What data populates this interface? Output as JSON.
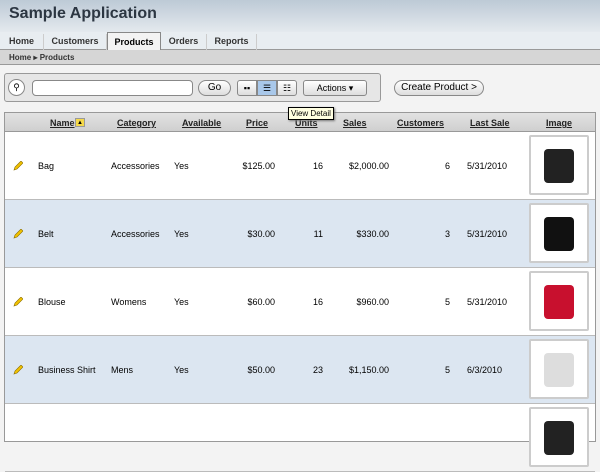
{
  "app": {
    "title": "Sample Application"
  },
  "tabs": [
    "Home",
    "Customers",
    "Products",
    "Orders",
    "Reports"
  ],
  "breadcrumb": {
    "home": "Home",
    "sep": "▸",
    "current": "Products"
  },
  "toolbar": {
    "search_value": "",
    "go": "Go",
    "actions": "Actions",
    "create": "Create Product >",
    "tooltip": "View Detail"
  },
  "columns": [
    "Name",
    "Category",
    "Available",
    "Price",
    "Units",
    "Sales",
    "Customers",
    "Last Sale",
    "Image"
  ],
  "rows": [
    {
      "name": "Bag",
      "category": "Accessories",
      "available": "Yes",
      "price": "$125.00",
      "units": "16",
      "sales": "$2,000.00",
      "customers": "6",
      "last_sale": "5/31/2010"
    },
    {
      "name": "Belt",
      "category": "Accessories",
      "available": "Yes",
      "price": "$30.00",
      "units": "11",
      "sales": "$330.00",
      "customers": "3",
      "last_sale": "5/31/2010"
    },
    {
      "name": "Blouse",
      "category": "Womens",
      "available": "Yes",
      "price": "$60.00",
      "units": "16",
      "sales": "$960.00",
      "customers": "5",
      "last_sale": "5/31/2010"
    },
    {
      "name": "Business Shirt",
      "category": "Mens",
      "available": "Yes",
      "price": "$50.00",
      "units": "23",
      "sales": "$1,150.00",
      "customers": "5",
      "last_sale": "6/3/2010"
    }
  ]
}
